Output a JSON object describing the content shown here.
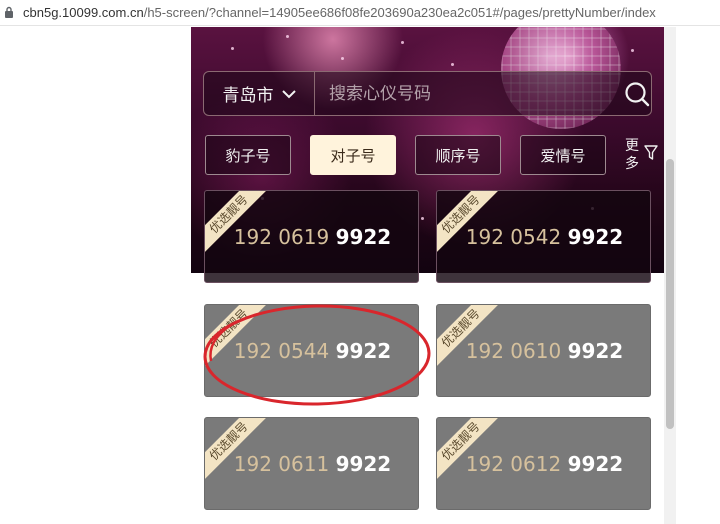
{
  "browser": {
    "url_host": "cbn5g.10099.com.cn",
    "url_path": "/h5-screen/?channel=14905ee686f08fe203690a230ea2c051#/pages/prettyNumber/index"
  },
  "search": {
    "city": "青岛市",
    "placeholder": "搜索心仪号码"
  },
  "tabs": [
    {
      "label": "豹子号"
    },
    {
      "label": "对子号"
    },
    {
      "label": "顺序号"
    },
    {
      "label": "爱情号"
    }
  ],
  "active_tab": "对子号",
  "more": {
    "line1": "更",
    "line2": "多"
  },
  "cards": [
    {
      "badge": "优选靓号",
      "prefix": "192 0619",
      "tail": "9922"
    },
    {
      "badge": "优选靓号",
      "prefix": "192 0542",
      "tail": "9922"
    },
    {
      "badge": "优选靓号",
      "prefix": "192 0544",
      "tail": "9922"
    },
    {
      "badge": "优选靓号",
      "prefix": "192 0610",
      "tail": "9922"
    },
    {
      "badge": "优选靓号",
      "prefix": "192 0611",
      "tail": "9922"
    },
    {
      "badge": "优选靓号",
      "prefix": "192 0612",
      "tail": "9922"
    }
  ],
  "colors": {
    "accent_gold": "#d6c19d",
    "active_tab_bg": "#fff3dc",
    "annotation_red": "#d9262c"
  }
}
